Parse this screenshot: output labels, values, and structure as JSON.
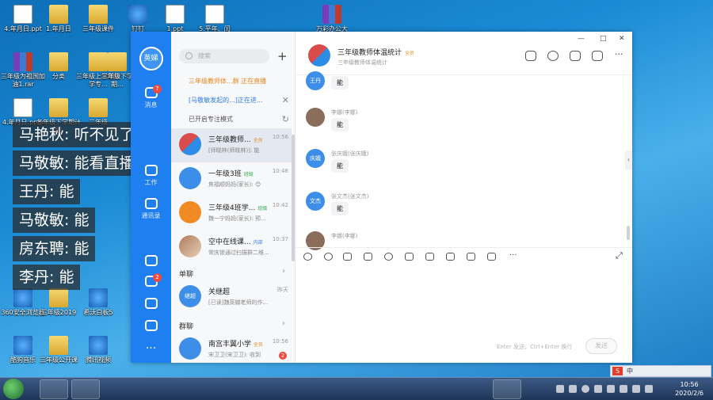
{
  "desktop": {
    "icons": [
      {
        "label": "4.年月日.ppt"
      },
      {
        "label": "1.年月日"
      },
      {
        "label": "三年级课件"
      },
      {
        "label": "钉钉"
      },
      {
        "label": "1.ppt"
      },
      {
        "label": "5.平年、闰"
      },
      {
        "label": "万彩办公大"
      },
      {
        "label": "三年级为祖国加油1.rar"
      },
      {
        "label": "分类"
      },
      {
        "label": "三年级上学期数学专..."
      },
      {
        "label": "三年级下学期..."
      },
      {
        "label": "4.年月日.pptx"
      },
      {
        "label": "各年级下学期计划"
      },
      {
        "label": "三年级"
      },
      {
        "label": "360安全浏览器"
      },
      {
        "label": "三年级2019"
      },
      {
        "label": "希沃白板5"
      },
      {
        "label": "酷狗音乐"
      },
      {
        "label": "三年级公开课"
      },
      {
        "label": "腾讯视频"
      }
    ]
  },
  "subtitles": [
    {
      "speaker": "马艳秋",
      "text": "听不见了?"
    },
    {
      "speaker": "马敬敏",
      "text": "能看直播回放吗"
    },
    {
      "speaker": "王丹",
      "text": "能"
    },
    {
      "speaker": "马敬敏",
      "text": "能"
    },
    {
      "speaker": "房东聘",
      "text": "能"
    },
    {
      "speaker": "李丹",
      "text": "能"
    }
  ],
  "rail": {
    "avatar_text": "英娣",
    "items": [
      {
        "label": "消息",
        "badge": "7"
      },
      {
        "label": "工作",
        "badge": ""
      },
      {
        "label": "通讯录",
        "badge": ""
      },
      {
        "label": "",
        "badge": "2"
      }
    ]
  },
  "list": {
    "search_placeholder": "搜索",
    "plus": "+",
    "notices": [
      {
        "text": "三年级教师体...群 正在直播"
      },
      {
        "text": "[马敬敏发起的...]正在进..."
      },
      {
        "text": "已开启专注模式"
      }
    ],
    "conversations": [
      {
        "name": "三年级教师...",
        "tag": "全员",
        "time": "10:56",
        "preview": "[师晓林(师晓林)]: 能",
        "badge": ""
      },
      {
        "name": "一年级3班",
        "tag": "班级",
        "time": "10:48",
        "preview": "焦福顺妈妈(家长): 😊",
        "badge": ""
      },
      {
        "name": "三年级4班学...",
        "tag": "班级",
        "time": "10:42",
        "preview": "魏一宁妈妈(家长): 预...",
        "badge": ""
      },
      {
        "name": "空中在线课...",
        "tag": "内部",
        "time": "10:37",
        "preview": "常庆锁通过扫描群二维...",
        "badge": ""
      }
    ],
    "single_chat_label": "单聊",
    "single": {
      "name": "关继超",
      "time": "昨天",
      "preview": "[已读]魏英娣老师的作...",
      "avatar": "继超"
    },
    "group_chat_label": "群聊",
    "group": {
      "name": "南宫丰翼小学",
      "tag": "全员",
      "time": "10:56",
      "preview": "宋卫卫(宋卫卫): 收到",
      "badge": "2"
    },
    "chevron": "›"
  },
  "chat": {
    "title": "三年级教师体温统计",
    "title_tag": "全员",
    "subtitle": "三年级教师体温统计",
    "messages": [
      {
        "avatar": "王丹",
        "sender": "",
        "text": "能",
        "color": "#3d8ee8"
      },
      {
        "avatar": "",
        "sender": "李娜(李娜)",
        "text": "能",
        "color": "#8a6d5a"
      },
      {
        "avatar": "庆娥",
        "sender": "张庆娥(张庆娥)",
        "text": "能",
        "color": "#3d8ee8"
      },
      {
        "avatar": "文杰",
        "sender": "张文杰(张文杰)",
        "text": "能",
        "color": "#3d8ee8"
      },
      {
        "avatar": "",
        "sender": "李娜(李娜)",
        "text": "",
        "color": "#8a6d5a"
      }
    ],
    "send_hint": "Enter 发送，Ctrl+Enter 换行",
    "send_label": "发送",
    "window_controls": [
      "—",
      "□",
      "✕"
    ],
    "more": "···"
  },
  "taskbar": {
    "time": "10:56",
    "date": "2020/2/6",
    "ime_label": "中"
  },
  "colors": {
    "accent": "#1f7ff0",
    "badge": "#f04a3f"
  }
}
